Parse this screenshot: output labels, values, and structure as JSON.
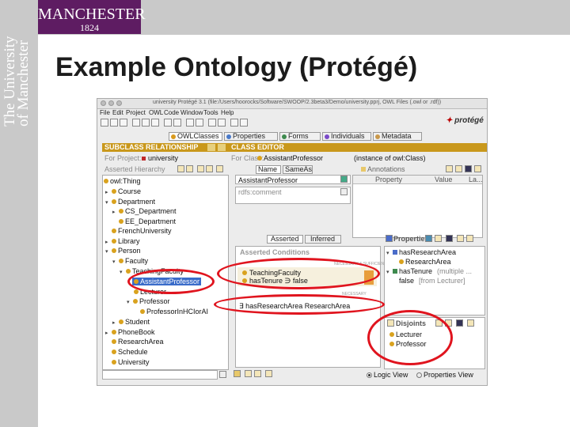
{
  "slide": {
    "logo_name": "MANCHESTER",
    "logo_year": "1824",
    "vertical_text_1": "The University",
    "vertical_text_2": "of Manchester",
    "title": "Example Ontology (Protégé)"
  },
  "window": {
    "title": "university  Protégé 3.1    (file:/Users/hoorocks/Software/SWOOP/2.3beta3/Demo/university.pprj, OWL Files (.owl or .rdf))",
    "brand": "protégé",
    "menu": [
      "File",
      "Edit",
      "Project",
      "OWL",
      "Code",
      "Window",
      "Tools",
      "Help"
    ],
    "tabs": [
      "OWLClasses",
      "Properties",
      "Forms",
      "Individuals",
      "Metadata"
    ]
  },
  "subclass_panel": {
    "header": "SUBCLASS RELATIONSHIP",
    "for_project_label": "For Project:",
    "for_project_value": "university",
    "asserted_hierarchy": "Asserted Hierarchy",
    "tree": [
      "owl:Thing",
      "Course",
      "Department",
      "CS_Department",
      "EE_Department",
      "FrenchUniversity",
      "Library",
      "Person",
      "Faculty",
      "TeachingFaculty",
      "AssistantProfessor",
      "Lecturer",
      "Professor",
      "ProfessorInHCIorAI",
      "Student",
      "PhoneBook",
      "ResearchArea",
      "Schedule",
      "University"
    ]
  },
  "class_editor": {
    "header": "CLASS EDITOR",
    "for_class_label": "For Class:",
    "for_class_value": "AssistantProfessor",
    "instance_of": "(instance of owl:Class)",
    "name_col": "Name",
    "sameas_col": "SameAs",
    "annotations_label": "Annotations",
    "property_col": "Property",
    "value_col": "Value",
    "lang_col": "La...",
    "name_value": "AssistantProfessor",
    "comment_label": "rdfs:comment",
    "asserted_tab": "Asserted",
    "inferred_tab": "Inferred",
    "asserted_conditions": "Asserted Conditions",
    "necessary_sufficient": "NECESSARY & SUFFICIENT",
    "necessary": "NECESSARY",
    "conditions": [
      "TeachingFaculty",
      "hasTenure ∋ false"
    ],
    "inherited": "∃ hasResearchArea ResearchArea",
    "properties_label": "Properties",
    "props": [
      "hasResearchArea",
      "ResearchArea",
      "hasTenure",
      "(multiple ...",
      "false",
      "[from Lecturer]"
    ],
    "disjoints_label": "Disjoints",
    "disjoints": [
      "Lecturer",
      "Professor"
    ],
    "logic_view": "Logic View",
    "properties_view": "Properties View"
  }
}
